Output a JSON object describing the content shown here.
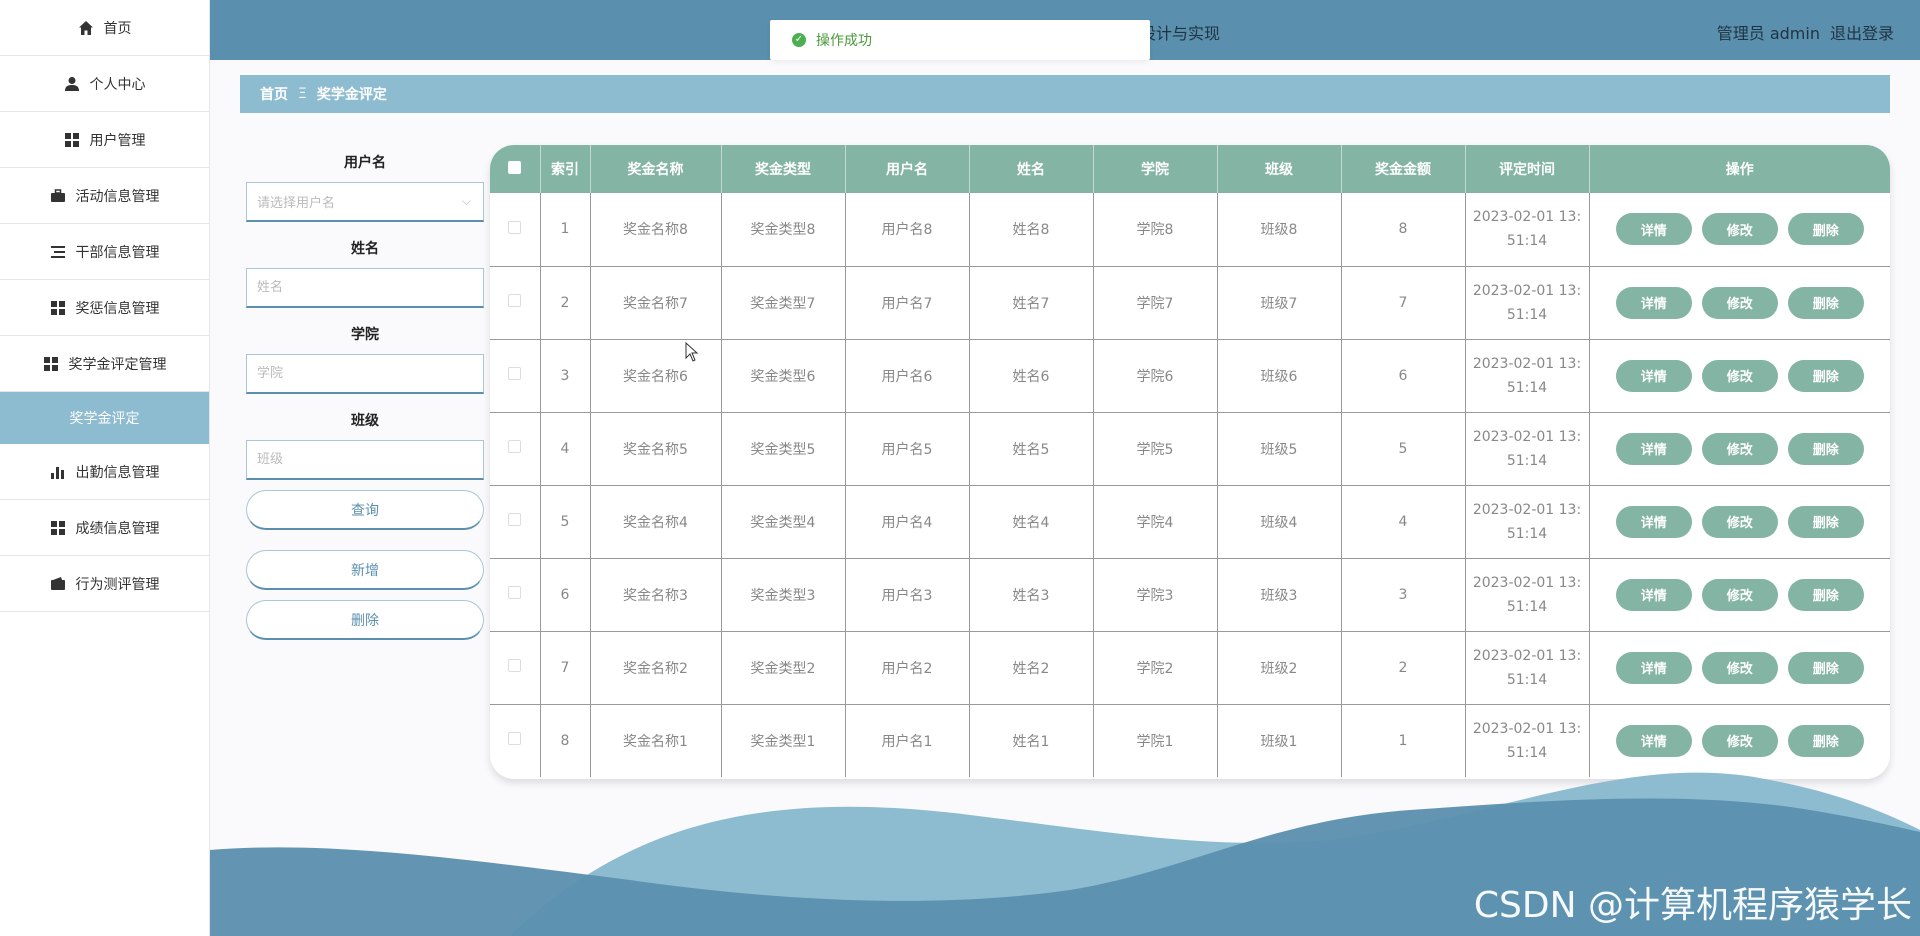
{
  "sidebar": {
    "items": [
      {
        "label": "首页",
        "icon": "home-icon"
      },
      {
        "label": "个人中心",
        "icon": "user-icon"
      },
      {
        "label": "用户管理",
        "icon": "grid-icon"
      },
      {
        "label": "活动信息管理",
        "icon": "briefcase-icon"
      },
      {
        "label": "干部信息管理",
        "icon": "list-icon"
      },
      {
        "label": "奖惩信息管理",
        "icon": "grid-icon"
      },
      {
        "label": "奖学金评定管理",
        "icon": "grid-icon"
      },
      {
        "label": "奖学金评定",
        "icon": "",
        "active": true
      },
      {
        "label": "出勤信息管理",
        "icon": "bar-chart-icon"
      },
      {
        "label": "成绩信息管理",
        "icon": "grid-icon"
      },
      {
        "label": "行为测评管理",
        "icon": "wallet-icon"
      }
    ]
  },
  "header": {
    "title_fragment": "设计与实现",
    "user_label": "管理员 admin",
    "logout_label": "退出登录"
  },
  "toast": {
    "message": "操作成功"
  },
  "breadcrumb": {
    "home": "首页",
    "separator": "Ξ",
    "current": "奖学金评定"
  },
  "filters": {
    "username_label": "用户名",
    "username_placeholder": "请选择用户名",
    "name_label": "姓名",
    "name_placeholder": "姓名",
    "college_label": "学院",
    "college_placeholder": "学院",
    "class_label": "班级",
    "class_placeholder": "班级",
    "search_label": "查询",
    "add_label": "新增",
    "delete_label": "删除"
  },
  "table": {
    "headers": [
      "索引",
      "奖金名称",
      "奖金类型",
      "用户名",
      "姓名",
      "学院",
      "班级",
      "奖金金额",
      "评定时间",
      "操作"
    ],
    "rows": [
      {
        "index": "1",
        "name": "奖金名称8",
        "type": "奖金类型8",
        "username": "用户名8",
        "realname": "姓名8",
        "college": "学院8",
        "class": "班级8",
        "amount": "8",
        "time1": "2023-02-01 13:",
        "time2": "51:14"
      },
      {
        "index": "2",
        "name": "奖金名称7",
        "type": "奖金类型7",
        "username": "用户名7",
        "realname": "姓名7",
        "college": "学院7",
        "class": "班级7",
        "amount": "7",
        "time1": "2023-02-01 13:",
        "time2": "51:14"
      },
      {
        "index": "3",
        "name": "奖金名称6",
        "type": "奖金类型6",
        "username": "用户名6",
        "realname": "姓名6",
        "college": "学院6",
        "class": "班级6",
        "amount": "6",
        "time1": "2023-02-01 13:",
        "time2": "51:14"
      },
      {
        "index": "4",
        "name": "奖金名称5",
        "type": "奖金类型5",
        "username": "用户名5",
        "realname": "姓名5",
        "college": "学院5",
        "class": "班级5",
        "amount": "5",
        "time1": "2023-02-01 13:",
        "time2": "51:14"
      },
      {
        "index": "5",
        "name": "奖金名称4",
        "type": "奖金类型4",
        "username": "用户名4",
        "realname": "姓名4",
        "college": "学院4",
        "class": "班级4",
        "amount": "4",
        "time1": "2023-02-01 13:",
        "time2": "51:14"
      },
      {
        "index": "6",
        "name": "奖金名称3",
        "type": "奖金类型3",
        "username": "用户名3",
        "realname": "姓名3",
        "college": "学院3",
        "class": "班级3",
        "amount": "3",
        "time1": "2023-02-01 13:",
        "time2": "51:14"
      },
      {
        "index": "7",
        "name": "奖金名称2",
        "type": "奖金类型2",
        "username": "用户名2",
        "realname": "姓名2",
        "college": "学院2",
        "class": "班级2",
        "amount": "2",
        "time1": "2023-02-01 13:",
        "time2": "51:14"
      },
      {
        "index": "8",
        "name": "奖金名称1",
        "type": "奖金类型1",
        "username": "用户名1",
        "realname": "姓名1",
        "college": "学院1",
        "class": "班级1",
        "amount": "1",
        "time1": "2023-02-01 13:",
        "time2": "51:14"
      }
    ],
    "actions": {
      "detail": "详情",
      "edit": "修改",
      "delete": "删除"
    }
  },
  "watermark": "CSDN @计算机程序猿学长",
  "colors": {
    "header": "#5b8fae",
    "accent": "#8dbcd0",
    "table_header": "#84b4a4",
    "success": "#4caf50"
  }
}
